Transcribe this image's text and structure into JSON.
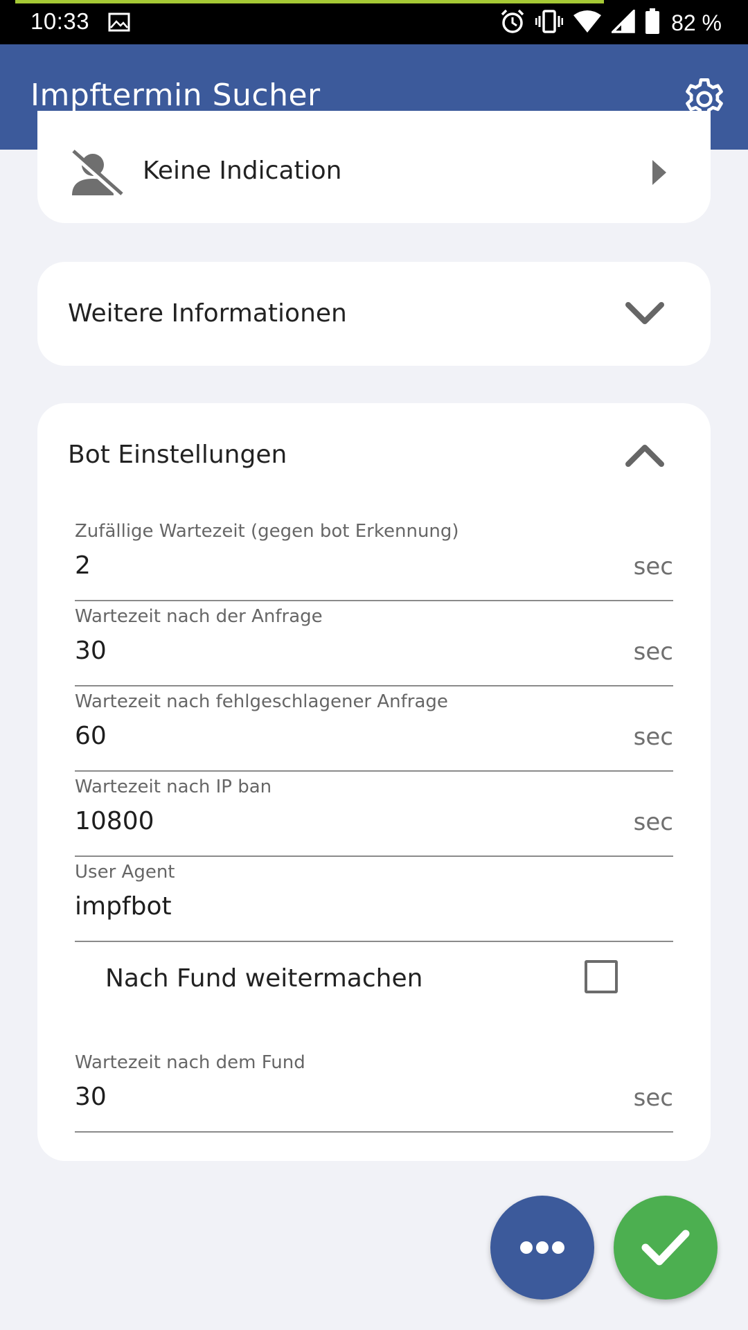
{
  "status_bar": {
    "time": "10:33",
    "battery_percent": "82 %",
    "icons": [
      "image-icon",
      "alarm-icon",
      "vibrate-icon",
      "wifi-icon",
      "signal-icon",
      "battery-icon"
    ]
  },
  "app_bar": {
    "title": "Impftermin Sucher",
    "settings_icon": "gear-icon",
    "color": "#3c5a9b"
  },
  "indication_card": {
    "label": "Keine Indication",
    "icon": "person-off-icon",
    "arrow_icon": "arrow-right-icon"
  },
  "weitere_card": {
    "title": "Weitere Informationen",
    "expanded": false
  },
  "bot_card": {
    "title": "Bot Einstellungen",
    "expanded": true,
    "fields": [
      {
        "label": "Zufällige Wartezeit (gegen bot Erkennung)",
        "value": "2",
        "suffix": "sec"
      },
      {
        "label": "Wartezeit nach der Anfrage",
        "value": "30",
        "suffix": "sec"
      },
      {
        "label": "Wartezeit nach fehlgeschlagener Anfrage",
        "value": "60",
        "suffix": "sec"
      },
      {
        "label": "Wartezeit nach IP ban",
        "value": "10800",
        "suffix": "sec"
      },
      {
        "label": "User Agent",
        "value": "impfbot",
        "suffix": ""
      },
      {
        "label": "Wartezeit nach dem Fund",
        "value": "30",
        "suffix": "sec"
      }
    ],
    "continue_after_find": {
      "label": "Nach Fund weitermachen",
      "checked": false
    }
  },
  "fabs": {
    "more_icon": "more-horiz-icon",
    "confirm_icon": "check-icon",
    "more_color": "#3c5a9b",
    "confirm_color": "#4caf50"
  }
}
